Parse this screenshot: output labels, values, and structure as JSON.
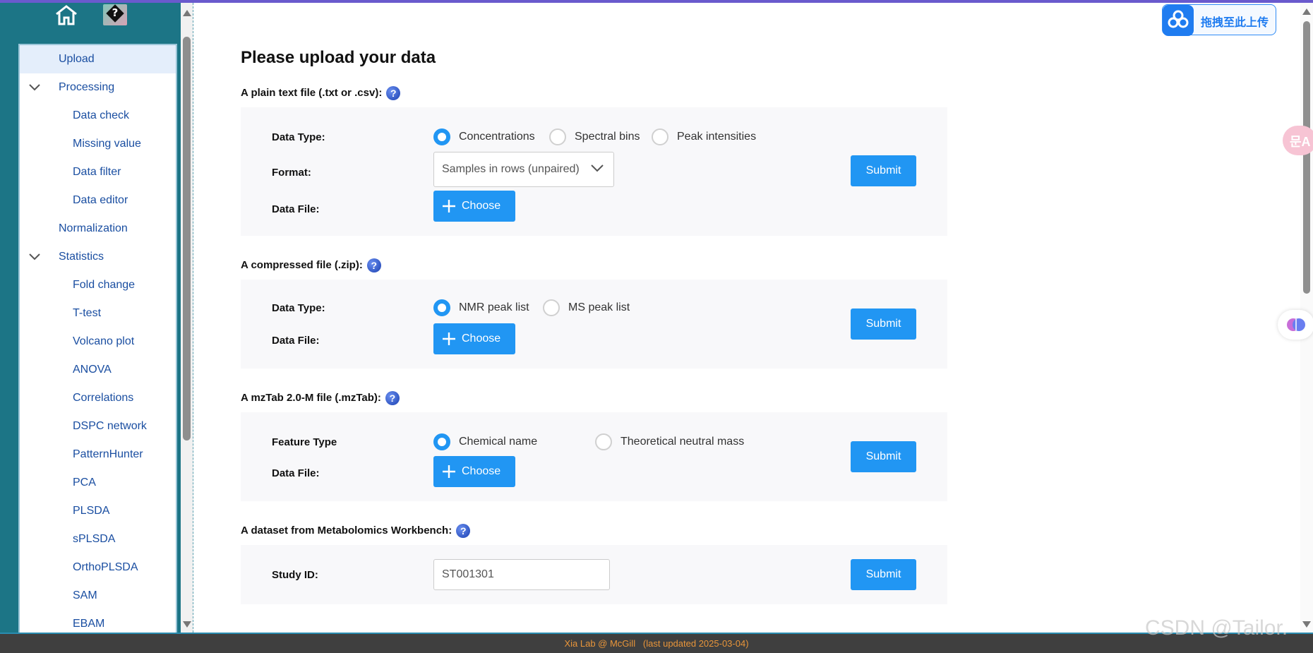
{
  "sidebar": {
    "items": [
      {
        "label": "Upload",
        "level": 1,
        "active": true,
        "expandable": false
      },
      {
        "label": "Processing",
        "level": 1,
        "active": false,
        "expandable": true
      },
      {
        "label": "Data check",
        "level": 2
      },
      {
        "label": "Missing value",
        "level": 2
      },
      {
        "label": "Data filter",
        "level": 2
      },
      {
        "label": "Data editor",
        "level": 2
      },
      {
        "label": "Normalization",
        "level": 1,
        "expandable": false
      },
      {
        "label": "Statistics",
        "level": 1,
        "expandable": true
      },
      {
        "label": "Fold change",
        "level": 2
      },
      {
        "label": "T-test",
        "level": 2
      },
      {
        "label": "Volcano plot",
        "level": 2
      },
      {
        "label": "ANOVA",
        "level": 2
      },
      {
        "label": "Correlations",
        "level": 2
      },
      {
        "label": "DSPC network",
        "level": 2
      },
      {
        "label": "PatternHunter",
        "level": 2
      },
      {
        "label": "PCA",
        "level": 2
      },
      {
        "label": "PLSDA",
        "level": 2
      },
      {
        "label": "sPLSDA",
        "level": 2
      },
      {
        "label": "OrthoPLSDA",
        "level": 2
      },
      {
        "label": "SAM",
        "level": 2
      },
      {
        "label": "EBAM",
        "level": 2
      }
    ],
    "home_icon": "home-icon",
    "help_icon": "help-icon"
  },
  "main": {
    "title": "Please upload your data",
    "sections": {
      "plain": {
        "heading": "A plain text file (.txt or .csv):",
        "data_type_label": "Data Type:",
        "options": [
          "Concentrations",
          "Spectral bins",
          "Peak intensities"
        ],
        "format_label": "Format:",
        "format_value": "Samples in rows (unpaired)",
        "file_label": "Data File:",
        "choose": "Choose",
        "submit": "Submit"
      },
      "zip": {
        "heading": "A compressed file (.zip):",
        "data_type_label": "Data Type:",
        "options": [
          "NMR peak list",
          "MS peak list"
        ],
        "file_label": "Data File:",
        "choose": "Choose",
        "submit": "Submit"
      },
      "mztab": {
        "heading": "A mzTab 2.0-M file (.mzTab):",
        "feature_label": "Feature Type",
        "options": [
          "Chemical name",
          "Theoretical neutral mass"
        ],
        "file_label": "Data File:",
        "choose": "Choose",
        "submit": "Submit"
      },
      "workbench": {
        "heading": "A dataset from Metabolomics Workbench:",
        "study_label": "Study ID:",
        "study_value": "ST001301",
        "submit": "Submit"
      }
    }
  },
  "extension": {
    "baidu_label": "拖拽至此上传",
    "translate_glyph": "문A"
  },
  "footer": {
    "text": "Xia Lab @ McGill   (last updated 2025-03-04)"
  },
  "watermark": "CSDN @Tailor.",
  "colors": {
    "sidebar": "#1c7586",
    "accent": "#2196f3",
    "link": "#1a4ea1",
    "footer_text": "#e8953a"
  }
}
